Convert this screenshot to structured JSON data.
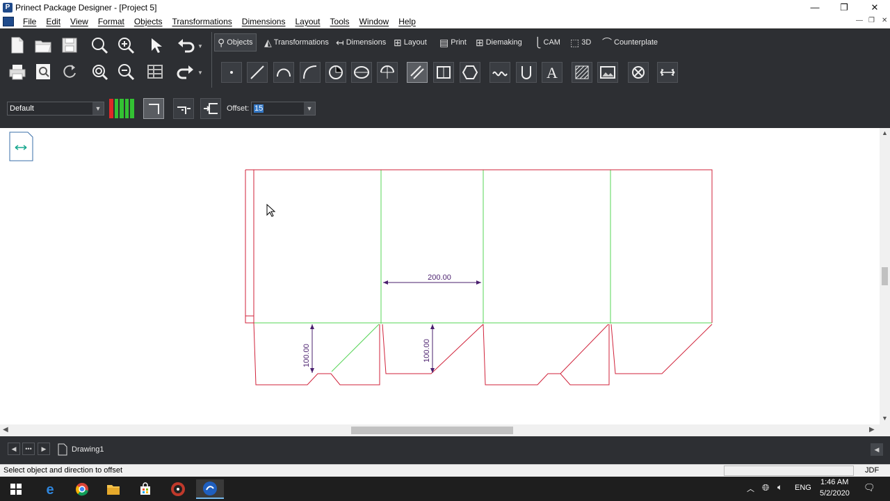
{
  "window": {
    "title": "Prinect Package Designer - [Project 5]",
    "controls": {
      "minimize": "—",
      "restore": "❐",
      "close": "✕"
    }
  },
  "menu": {
    "items": [
      "File",
      "Edit",
      "View",
      "Format",
      "Objects",
      "Transformations",
      "Dimensions",
      "Layout",
      "Tools",
      "Window",
      "Help"
    ]
  },
  "tabs": [
    {
      "label": "Objects",
      "icon": "objects-icon",
      "active": true
    },
    {
      "label": "Transformations",
      "icon": "transformations-icon"
    },
    {
      "label": "Dimensions",
      "icon": "dimensions-icon"
    },
    {
      "label": "Layout",
      "icon": "layout-icon"
    },
    {
      "label": "Print",
      "icon": "print-icon"
    },
    {
      "label": "Diemaking",
      "icon": "diemaking-icon"
    },
    {
      "label": "CAM",
      "icon": "cam-icon"
    },
    {
      "label": "3D",
      "icon": "3d-icon"
    },
    {
      "label": "Counterplate",
      "icon": "counterplate-icon"
    }
  ],
  "properties": {
    "style_select": "Default",
    "offset_label": "Offset:",
    "offset_value": "15"
  },
  "canvas": {
    "dimension_horizontal": "200.00",
    "dimension_vertical_1": "100.00",
    "dimension_vertical_2": "100.00",
    "colors": {
      "cut": "#d0223a",
      "crease": "#55d455",
      "dimension": "#4a1f6e"
    }
  },
  "drawing_tabs": {
    "active": "Drawing1"
  },
  "status": {
    "message": "Select object and direction to offset",
    "format": "JDF"
  },
  "taskbar": {
    "language": "ENG",
    "time": "1:46 AM",
    "date": "5/2/2020"
  }
}
